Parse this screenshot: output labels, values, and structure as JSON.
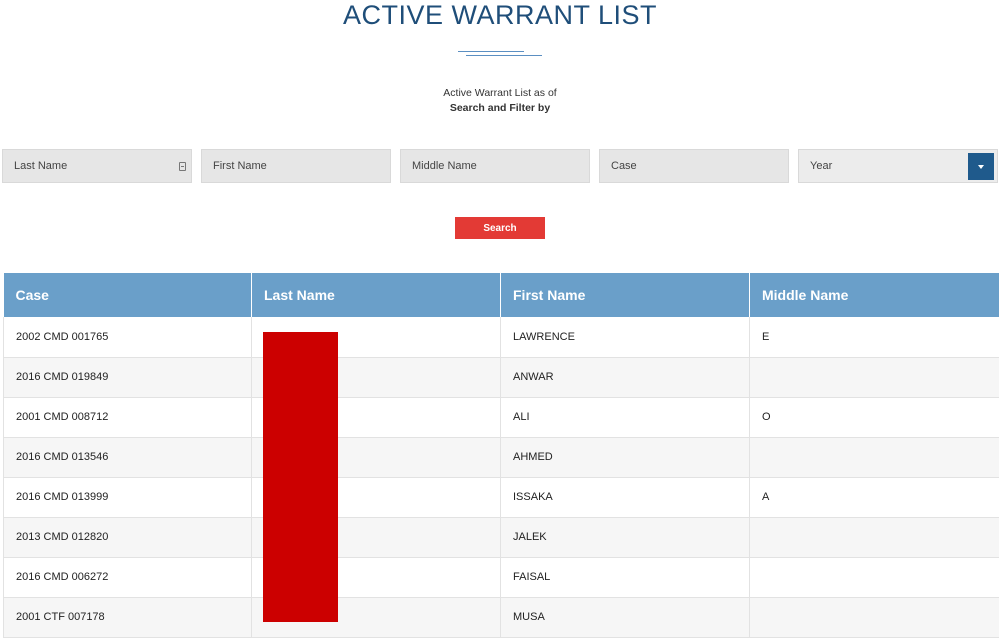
{
  "page": {
    "title": "ACTIVE WARRANT LIST",
    "subtitle": "Active Warrant List as of",
    "filter_heading": "Search and Filter by"
  },
  "filters": {
    "last_name": "Last Name",
    "first_name": "First Name",
    "middle_name": "Middle Name",
    "case": "Case",
    "year": "Year"
  },
  "search_button": "Search",
  "colors": {
    "title": "#1f4e79",
    "header": "#6a9fc9",
    "search_button": "#e33a35",
    "year_toggle": "#1f5a8c",
    "redaction": "#cc0000"
  },
  "table": {
    "columns": [
      "Case",
      "Last Name",
      "First Name",
      "Middle Name"
    ],
    "rows": [
      [
        "2002 CMD 001765",
        "",
        "LAWRENCE",
        "E"
      ],
      [
        "2016 CMD 019849",
        "",
        "ANWAR",
        ""
      ],
      [
        "2001 CMD 008712",
        "",
        "ALI",
        "O"
      ],
      [
        "2016 CMD 013546",
        "",
        "AHMED",
        ""
      ],
      [
        "2016 CMD 013999",
        "",
        "ISSAKA",
        "A"
      ],
      [
        "2013 CMD 012820",
        "",
        "JALEK",
        ""
      ],
      [
        "2016 CMD 006272",
        "",
        "FAISAL",
        ""
      ],
      [
        "2001 CTF 007178",
        "",
        "MUSA",
        ""
      ]
    ]
  }
}
